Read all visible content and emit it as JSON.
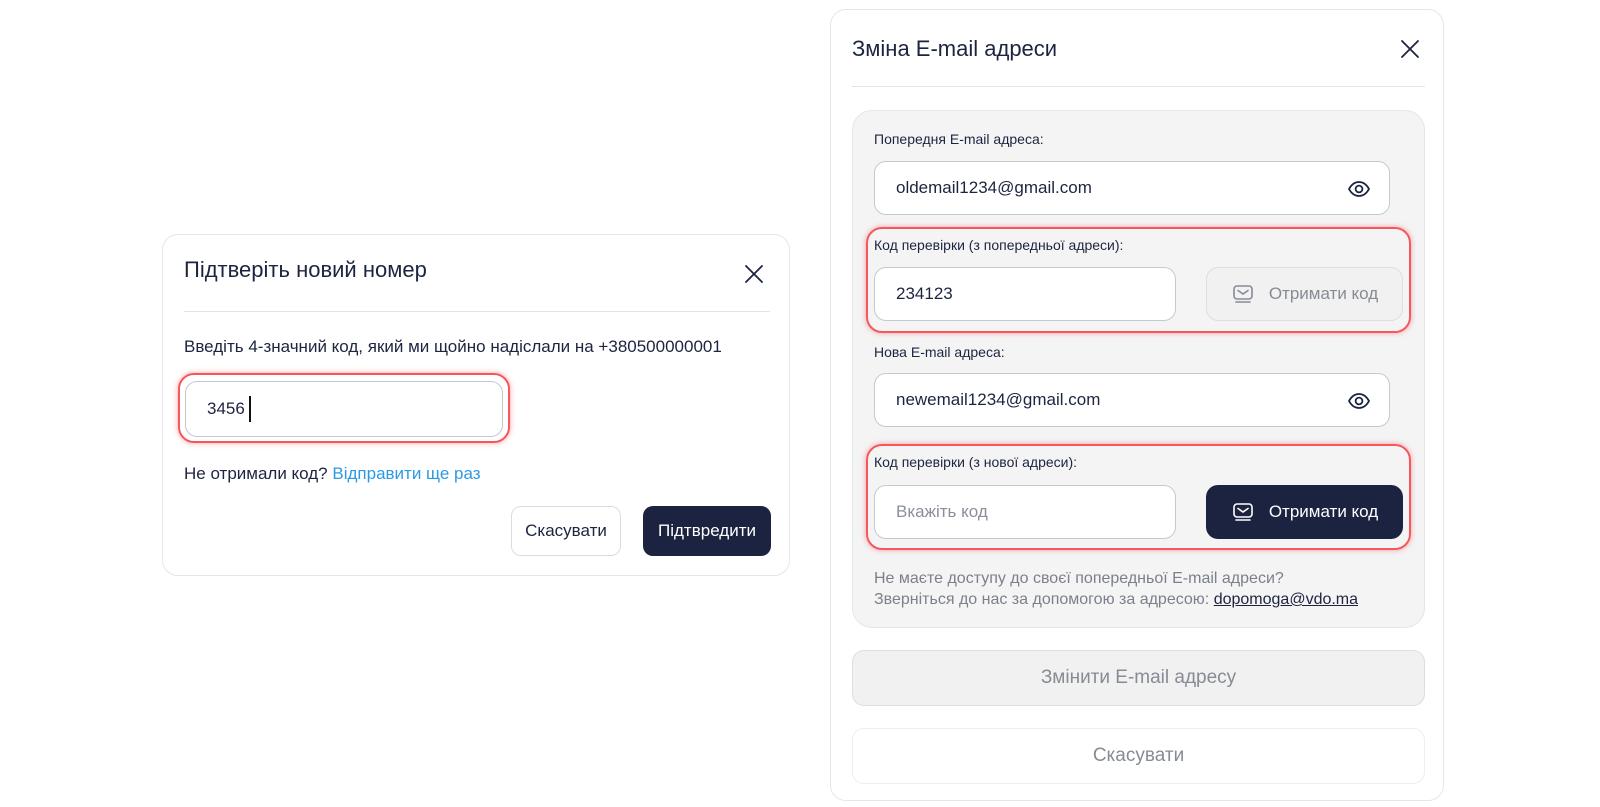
{
  "phone_modal": {
    "title": "Підтверіть новий номер",
    "description": "Введіть 4-значний код, який ми щойно надіслали на +380500000001",
    "code_value": "3456",
    "resend_prompt": "Не отримали код?",
    "resend_link": "Відправити ще раз",
    "cancel_label": "Скасувати",
    "confirm_label": "Підтвредити"
  },
  "email_modal": {
    "title": "Зміна E-mail адреси",
    "old_email_label": "Попередня E-mail адреса:",
    "old_email_value": "oldemail1234@gmail.com",
    "old_code_label": "Код перевірки (з попередньої адреси):",
    "old_code_value": "234123",
    "old_code_button": "Отримати код",
    "new_email_label": "Нова E-mail адреса:",
    "new_email_value": "newemail1234@gmail.com",
    "new_code_label": "Код перевірки (з нової адреси):",
    "new_code_placeholder": "Вкажіть код",
    "new_code_button": "Отримати код",
    "help_line1": "Не маєте доступу до своєї попередньої E-mail адреси?",
    "help_line2": "Зверніться до нас за допомогою за адресою:",
    "help_email": "dopomoga@vdo.ma",
    "submit_label": "Змінити E-mail адресу",
    "cancel_label": "Скасувати"
  },
  "colors": {
    "primary": "#1c2340",
    "link": "#2b9ae3",
    "highlight": "#f4585c",
    "panel": "#f4f4f5"
  },
  "icons": [
    "close-icon",
    "eye-icon",
    "message-icon"
  ]
}
